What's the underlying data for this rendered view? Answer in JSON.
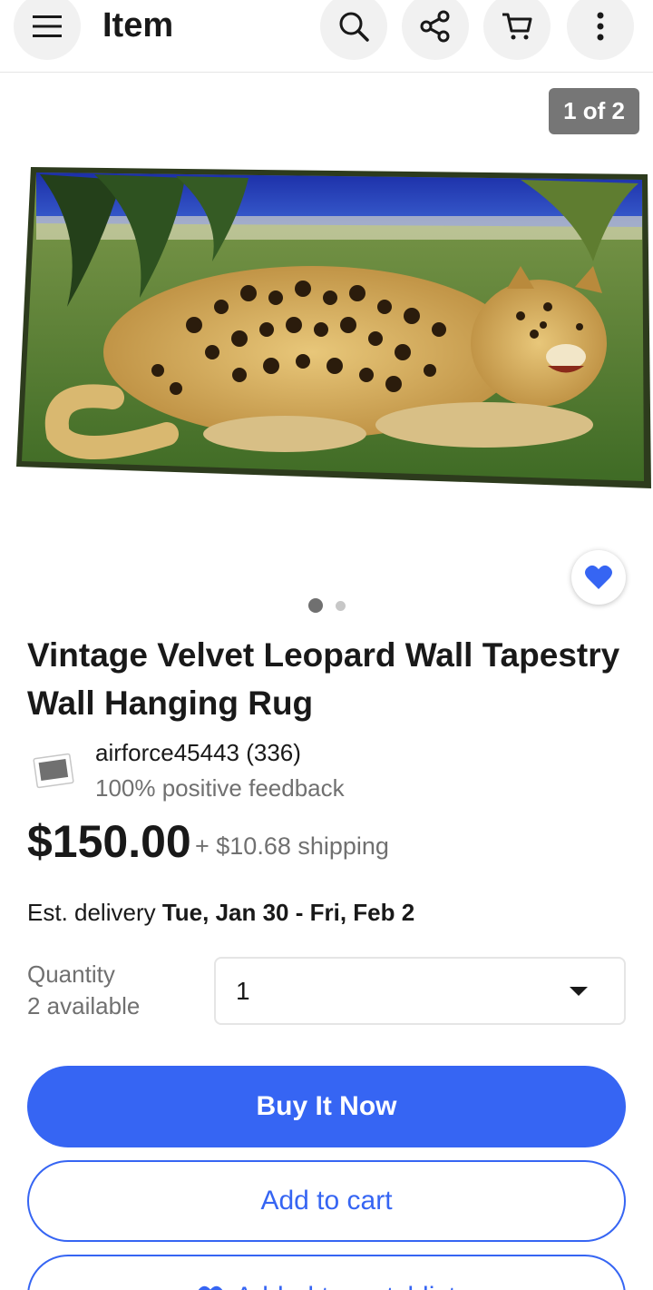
{
  "header": {
    "title": "Item",
    "icons": [
      "menu-icon",
      "search-icon",
      "share-icon",
      "cart-icon",
      "more-icon"
    ]
  },
  "gallery": {
    "counter": "1 of 2",
    "current_index": 1,
    "total": 2
  },
  "item": {
    "title": "Vintage Velvet Leopard Wall Tapestry Wall Hanging Rug",
    "seller_name": "airforce45443 (336)",
    "seller_feedback": "100% positive feedback",
    "price": "$150.00",
    "shipping": "+ $10.68 shipping",
    "delivery_label": "Est. delivery ",
    "delivery_dates": "Tue, Jan 30 - Fri, Feb 2"
  },
  "quantity": {
    "label": "Quantity",
    "available": "2 available",
    "selected": "1"
  },
  "actions": {
    "buy_now": "Buy It Now",
    "add_to_cart": "Add to cart",
    "watchlist": "Added to watchlist"
  },
  "colors": {
    "accent": "#3665f3",
    "text": "#191919",
    "muted": "#707070"
  }
}
